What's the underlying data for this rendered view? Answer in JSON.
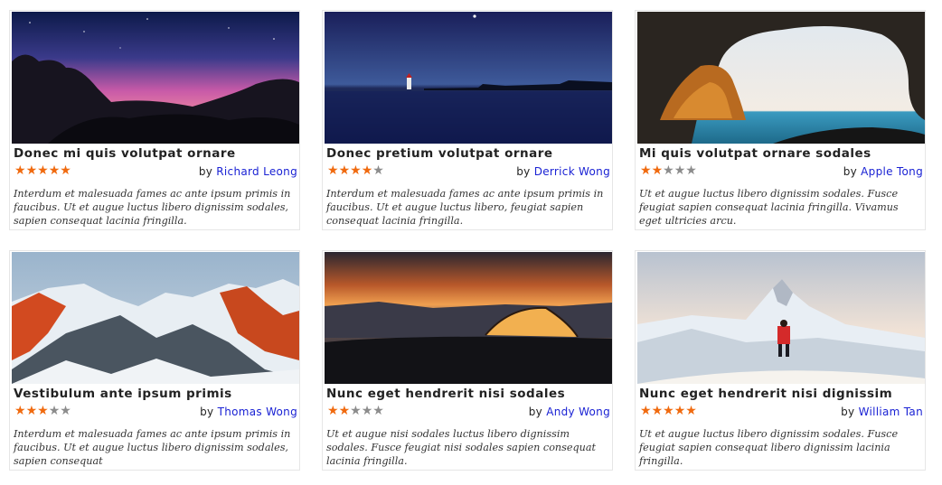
{
  "cards": [
    {
      "title": "Donec mi quis volutpat ornare",
      "rating": 5,
      "by_prefix": "by",
      "author": "Richard Leong",
      "description": "Interdum et malesuada fames ac ante ipsum primis in faucibus. Ut et augue luctus libero dignissim sodales, sapien consequat lacinia fringilla.",
      "image": "night-sky-rocks"
    },
    {
      "title": "Donec pretium volutpat ornare",
      "rating": 4,
      "by_prefix": "by",
      "author": "Derrick Wong",
      "description": "Interdum et malesuada fames ac ante ipsum primis in faucibus. Ut et augue luctus libero, feugiat sapien consequat lacinia fringilla.",
      "image": "lake-lighthouse-night"
    },
    {
      "title": "Mi quis volutpat ornare sodales",
      "rating": 2,
      "by_prefix": "by",
      "author": "Apple Tong",
      "description": "Ut et augue luctus libero dignissim sodales. Fusce feugiat sapien consequat lacinia fringilla. Vivamus eget ultricies arcu.",
      "image": "sea-cave-boat"
    },
    {
      "title": "Vestibulum ante ipsum primis",
      "rating": 3,
      "by_prefix": "by",
      "author": "Thomas Wong",
      "description": "Interdum et malesuada fames ac ante ipsum primis in faucibus. Ut et augue luctus libero dignissim sodales, sapien consequat",
      "image": "snowy-mountains-sunset"
    },
    {
      "title": "Nunc eget hendrerit nisi sodales",
      "rating": 2,
      "by_prefix": "by",
      "author": "Andy Wong",
      "description": "Ut et augue nisi sodales luctus libero dignissim sodales. Fusce feugiat nisi sodales sapien consequat lacinia fringilla.",
      "image": "tent-sunset"
    },
    {
      "title": "Nunc eget hendrerit nisi dignissim",
      "rating": 5,
      "by_prefix": "by",
      "author": "William Tan",
      "description": "Ut et augue luctus libero dignissim sodales. Fusce feugiat sapien consequat libero dignissim lacinia fringilla.",
      "image": "hiker-matterhorn"
    }
  ],
  "max_rating": 5,
  "colors": {
    "star_on": "#f06a0f",
    "star_off": "#8c8c8c",
    "author_link": "#1a22d4"
  }
}
